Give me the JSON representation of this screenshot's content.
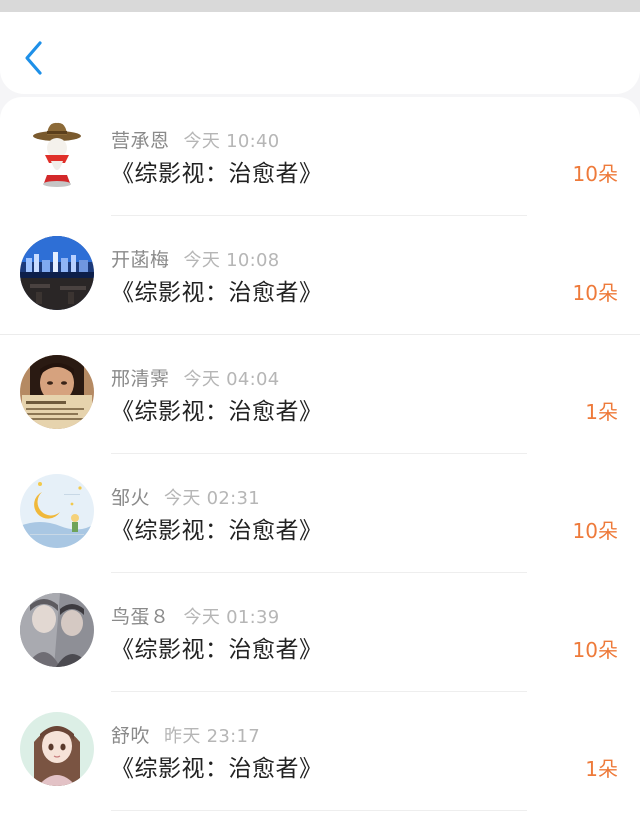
{
  "nav": {
    "back_icon": "chevron-left-icon",
    "accent": "#1e90e8"
  },
  "colors": {
    "count": "#ee7a3a",
    "name": "#8a8a8a",
    "time": "#b6b6b6"
  },
  "rows": [
    {
      "name": "营承恩",
      "time": "今天 10:40",
      "book": "《综影视：治愈者》",
      "count": "10朵",
      "avatar": "cowboy-hat-figure"
    },
    {
      "name": "开菡梅",
      "time": "今天 10:08",
      "book": "《综影视：治愈者》",
      "count": "10朵",
      "avatar": "city-night-skyline"
    },
    {
      "name": "邢清霁",
      "time": "今天 04:04",
      "book": "《综影视：治愈者》",
      "count": "1朵",
      "avatar": "woman-with-newspaper"
    },
    {
      "name": "邹火",
      "time": "今天 02:31",
      "book": "《综影视：治愈者》",
      "count": "10朵",
      "avatar": "moon-and-little-prince"
    },
    {
      "name": "鸟蛋８",
      "time": "今天 01:39",
      "book": "《综影视：治愈者》",
      "count": "10朵",
      "avatar": "two-people-photo"
    },
    {
      "name": "舒吹",
      "time": "昨天 23:17",
      "book": "《综影视：治愈者》",
      "count": "1朵",
      "avatar": "anime-girl"
    }
  ]
}
